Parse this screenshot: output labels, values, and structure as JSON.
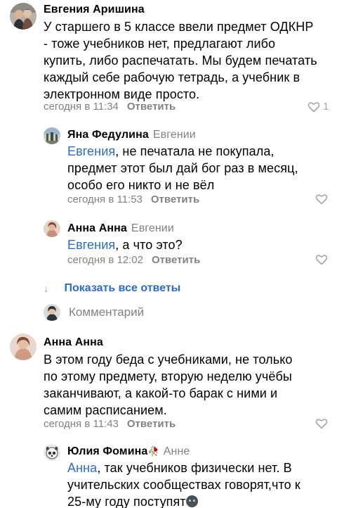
{
  "comments": [
    {
      "author": "Евгения Аришина",
      "lines": [
        "У старшего в 5 классе ввели предмет ОДКНР",
        "- тоже учебников нет, предлагают либо",
        "купить, либо распечатать. Мы будем печатать",
        "каждый себе рабочую тетрадь, а учебник в",
        "электронном виде просто."
      ],
      "time": "сегодня в 11:34",
      "reply_label": "Ответить",
      "likes": "1"
    },
    {
      "author": "Яна Федулина",
      "reply_to": "Евгении",
      "mention": "Евгения",
      "lines": [
        ", не печатала не покупала,",
        "предмет этот был дай бог раз в месяц,",
        "особо его никто и не вёл"
      ],
      "time": "сегодня в 11:53",
      "reply_label": "Ответить"
    },
    {
      "author": "Анна Анна",
      "reply_to": "Евгении",
      "mention": "Евгения",
      "lines": [
        ", а что это?"
      ],
      "time": "сегодня в 12:02",
      "reply_label": "Ответить"
    },
    {
      "author": "Анна Анна",
      "lines": [
        "В этом году беда с учебниками, не только",
        "по этому предмету, вторую неделю учёбы",
        "заканчивают, а какой-то барак с ними и",
        "самим расписанием."
      ],
      "time": "сегодня в 11:43",
      "reply_label": "Ответить"
    },
    {
      "author": "Юлия Фомина",
      "author_emoji": "🥀",
      "reply_to": "Анне",
      "mention": "Анна",
      "lines": [
        ", так учебников физически нет. В",
        "учительских сообществах говорят,что к",
        "25-му году поступят"
      ]
    }
  ],
  "show_all_replies": "Показать все ответы",
  "show_all_arrow": "↓",
  "composer_placeholder": "Комментарий",
  "colors": {
    "link": "#2a6bd1",
    "secondary": "#828282",
    "like_icon": "#a0a7b0"
  },
  "icons": {
    "like": "heart-outline-icon",
    "show_all": "arrow-down-icon",
    "emoji_end": "face-emoji-icon"
  }
}
